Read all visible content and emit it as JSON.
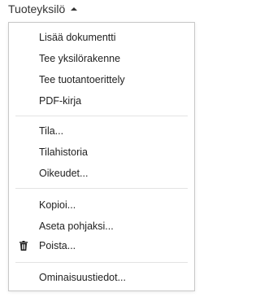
{
  "trigger": {
    "label": "Tuoteyksilö",
    "caret_icon": "caret-up-icon"
  },
  "menu": {
    "groups": [
      {
        "items": [
          {
            "label": "Lisää dokumentti"
          },
          {
            "label": "Tee yksilörakenne"
          },
          {
            "label": "Tee tuotantoerittely"
          },
          {
            "label": "PDF-kirja"
          }
        ]
      },
      {
        "items": [
          {
            "label": "Tila..."
          },
          {
            "label": "Tilahistoria"
          },
          {
            "label": "Oikeudet..."
          }
        ]
      },
      {
        "items": [
          {
            "label": "Kopioi..."
          },
          {
            "label": "Aseta pohjaksi..."
          },
          {
            "label": "Poista...",
            "icon": "trash-icon"
          }
        ]
      },
      {
        "items": [
          {
            "label": "Ominaisuustiedot..."
          }
        ]
      }
    ]
  },
  "colors": {
    "text": "#222222",
    "border": "#c8c8c8",
    "divider": "#e3e3e3"
  }
}
